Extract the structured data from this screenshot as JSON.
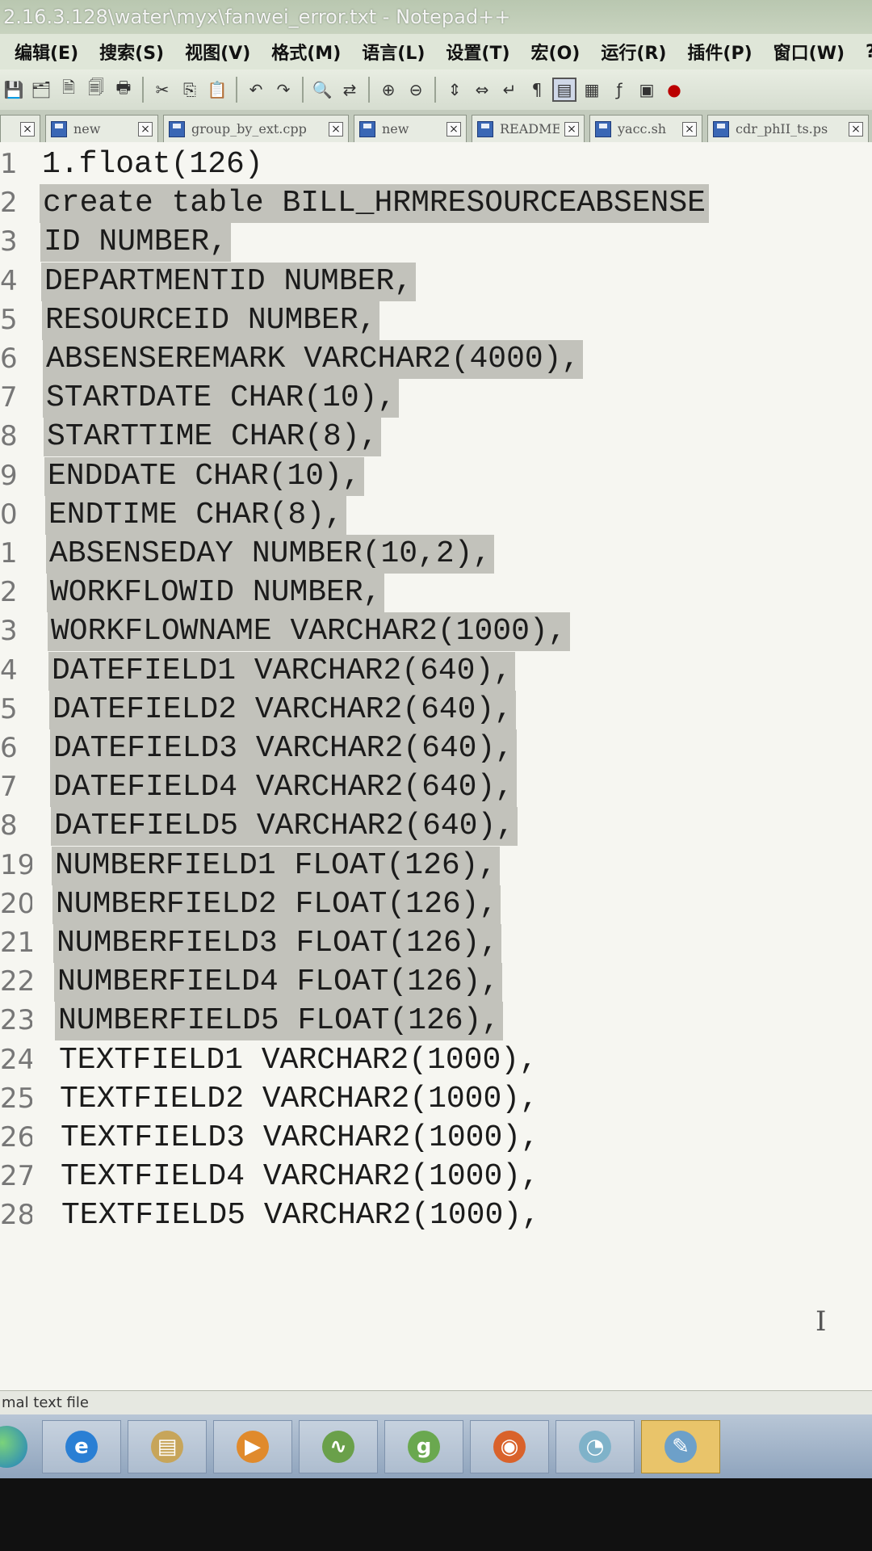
{
  "window": {
    "title": "2.16.3.128\\water\\myx\\fanwei_error.txt - Notepad++"
  },
  "menu": [
    "编辑(E)",
    "搜索(S)",
    "视图(V)",
    "格式(M)",
    "语言(L)",
    "设置(T)",
    "宏(O)",
    "运行(R)",
    "插件(P)",
    "窗口(W)",
    "?"
  ],
  "toolbar_icons": [
    "save-icon",
    "save-all-icon",
    "close-icon",
    "close-all-icon",
    "print-icon",
    "cut-icon",
    "copy-icon",
    "paste-icon",
    "undo-icon",
    "redo-icon",
    "find-icon",
    "replace-icon",
    "zoom-in-icon",
    "zoom-out-icon",
    "sync-vertical-icon",
    "sync-horizontal-icon",
    "word-wrap-icon",
    "show-all-chars-icon",
    "indent-guide-icon",
    "doc-map-icon",
    "function-list-icon",
    "folder-as-workspace-icon",
    "record-macro-icon"
  ],
  "tabs": [
    {
      "label": "",
      "active": false
    },
    {
      "label": "new",
      "active": false
    },
    {
      "label": "group_by_ext.cpp",
      "active": false
    },
    {
      "label": "new",
      "active": false
    },
    {
      "label": "README",
      "active": false
    },
    {
      "label": "yacc.sh",
      "active": false
    },
    {
      "label": "cdr_phII_ts.ps",
      "active": false
    }
  ],
  "lines": [
    {
      "num": "1",
      "text": "1.float(126)",
      "selected": false
    },
    {
      "num": "2",
      "text": "create table BILL_HRMRESOURCEABSENSE",
      "selected": true
    },
    {
      "num": "3",
      "text": "ID NUMBER,",
      "selected": true
    },
    {
      "num": "4",
      "text": "DEPARTMENTID NUMBER,",
      "selected": true
    },
    {
      "num": "5",
      "text": "RESOURCEID NUMBER,",
      "selected": true
    },
    {
      "num": "6",
      "text": "ABSENSEREMARK VARCHAR2(4000),",
      "selected": true
    },
    {
      "num": "7",
      "text": "STARTDATE CHAR(10),",
      "selected": true
    },
    {
      "num": "8",
      "text": "STARTTIME CHAR(8),",
      "selected": true
    },
    {
      "num": "9",
      "text": "ENDDATE CHAR(10),",
      "selected": true
    },
    {
      "num": "0",
      "text": "ENDTIME CHAR(8),",
      "selected": true
    },
    {
      "num": "1",
      "text": "ABSENSEDAY NUMBER(10,2),",
      "selected": true
    },
    {
      "num": "2",
      "text": "WORKFLOWID NUMBER,",
      "selected": true
    },
    {
      "num": "3",
      "text": "WORKFLOWNAME VARCHAR2(1000),",
      "selected": true
    },
    {
      "num": "4",
      "text": "DATEFIELD1 VARCHAR2(640),",
      "selected": true
    },
    {
      "num": "5",
      "text": "DATEFIELD2 VARCHAR2(640),",
      "selected": true
    },
    {
      "num": "6",
      "text": "DATEFIELD3 VARCHAR2(640),",
      "selected": true
    },
    {
      "num": "7",
      "text": "DATEFIELD4 VARCHAR2(640),",
      "selected": true
    },
    {
      "num": "8",
      "text": "DATEFIELD5 VARCHAR2(640),",
      "selected": true
    },
    {
      "num": "19",
      "text": "NUMBERFIELD1 FLOAT(126),",
      "selected": true
    },
    {
      "num": "20",
      "text": "NUMBERFIELD2 FLOAT(126),",
      "selected": true
    },
    {
      "num": "21",
      "text": "NUMBERFIELD3 FLOAT(126),",
      "selected": true
    },
    {
      "num": "22",
      "text": "NUMBERFIELD4 FLOAT(126),",
      "selected": true
    },
    {
      "num": "23",
      "text": "NUMBERFIELD5 FLOAT(126),",
      "selected": true
    },
    {
      "num": "24",
      "text": "TEXTFIELD1 VARCHAR2(1000),",
      "selected": false
    },
    {
      "num": "25",
      "text": "TEXTFIELD2 VARCHAR2(1000),",
      "selected": false
    },
    {
      "num": "26",
      "text": "TEXTFIELD3 VARCHAR2(1000),",
      "selected": false
    },
    {
      "num": "27",
      "text": "TEXTFIELD4 VARCHAR2(1000),",
      "selected": false
    },
    {
      "num": "28",
      "text": "TEXTFIELD5 VARCHAR2(1000),",
      "selected": false
    }
  ],
  "status": {
    "file_type": "mal text file"
  },
  "cursor_icon": "text-cursor-icon",
  "taskbar": {
    "items": [
      {
        "icon": "ie-icon",
        "color": "#2a7fd4",
        "active": false
      },
      {
        "icon": "explorer-icon",
        "color": "#c7a55a",
        "active": false
      },
      {
        "icon": "media-player-icon",
        "color": "#e08a2c",
        "active": false
      },
      {
        "icon": "monitor-icon",
        "color": "#6aa04a",
        "active": false
      },
      {
        "icon": "app-g-icon",
        "color": "#6aa84f",
        "active": false
      },
      {
        "icon": "firefox-icon",
        "color": "#d9622b",
        "active": false
      },
      {
        "icon": "gauge-icon",
        "color": "#7fb2c9",
        "active": false
      },
      {
        "icon": "notepadpp-icon",
        "color": "#6da0c9",
        "active": true
      }
    ]
  }
}
